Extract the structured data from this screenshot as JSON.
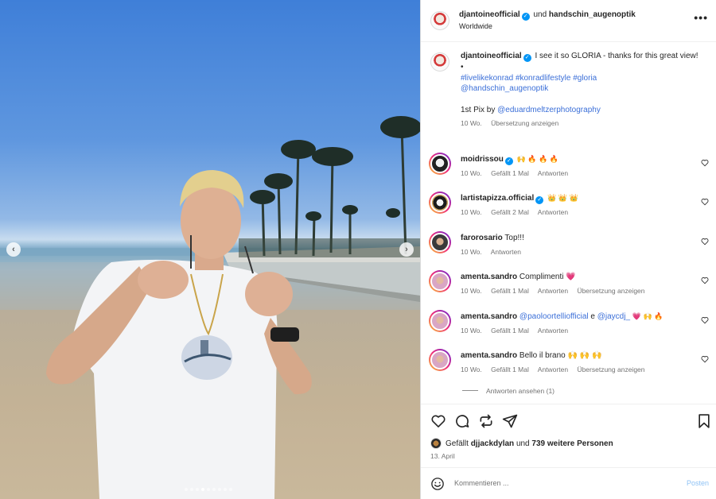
{
  "post": {
    "header": {
      "author": "djantoineofficial",
      "connector": "und",
      "collaborator": "handschin_augenoptik",
      "location": "Worldwide",
      "more_icon": "more-horizontal-icon"
    },
    "carousel": {
      "slide_count": 9,
      "active_slide": 4,
      "prev_icon": "chevron-left-icon",
      "next_icon": "chevron-right-icon"
    },
    "caption": {
      "author": "djantoineofficial",
      "text": "I see it so GLORIA - thanks for this great view!",
      "bullet": "•",
      "hashtag1": "#livelikekonrad",
      "hashtag2": "#konradlifestyle",
      "hashtag3": "#gloria",
      "mention": "@handschin_augenoptik",
      "credit_prefix": "1st Pix by",
      "credit_mention": "@eduardmeltzerphotography",
      "time": "10 Wo.",
      "translate": "Übersetzung anzeigen"
    },
    "comments": [
      {
        "user": "moidrissou",
        "verified": true,
        "text": "🙌 🔥 🔥 🔥",
        "time": "10 Wo.",
        "likes": "Gefällt 1 Mal",
        "reply": "Antworten",
        "translate": ""
      },
      {
        "user": "lartistapizza.official",
        "verified": true,
        "text": "👑 👑 👑",
        "time": "10 Wo.",
        "likes": "Gefällt 2 Mal",
        "reply": "Antworten",
        "translate": ""
      },
      {
        "user": "faroro­sario",
        "verified": false,
        "text": "Top!!!",
        "time": "10 Wo.",
        "likes": "",
        "reply": "Antworten",
        "translate": ""
      },
      {
        "user": "amenta.sandro",
        "verified": false,
        "text": "Complimenti 💗",
        "time": "10 Wo.",
        "likes": "Gefällt 1 Mal",
        "reply": "Antworten",
        "translate": "Übersetzung anzeigen"
      },
      {
        "user": "amenta.sandro",
        "verified": false,
        "mention1": "@paoloortelliofficial",
        "mid": "e",
        "mention2": "@jaycdj_",
        "text": "💗 🙌 🔥",
        "time": "10 Wo.",
        "likes": "Gefällt 1 Mal",
        "reply": "Antworten",
        "translate": ""
      },
      {
        "user": "amenta.sandro",
        "verified": false,
        "text": "Bello il brano 🙌 🙌 🙌",
        "time": "10 Wo.",
        "likes": "Gefällt 1 Mal",
        "reply": "Antworten",
        "translate": "Übersetzung anzeigen"
      }
    ],
    "view_replies": "Antworten ansehen (1)",
    "actions": {
      "like_icon": "heart-icon",
      "comment_icon": "comment-icon",
      "share_icon": "share-icon",
      "send_icon": "send-icon",
      "save_icon": "bookmark-icon"
    },
    "likes": {
      "prefix": "Gefällt",
      "user": "djjackdylan",
      "connector": "und",
      "others": "739 weitere Personen"
    },
    "date": "13. April",
    "add_comment": {
      "placeholder": "Kommentieren ...",
      "post_label": "Posten",
      "emoji_icon": "emoji-icon"
    }
  },
  "colors": {
    "link": "#3b6fd8",
    "verified": "#0095f6",
    "muted": "#737373",
    "post_button": "#8ec2f5",
    "like_heart": "#ed4956"
  }
}
